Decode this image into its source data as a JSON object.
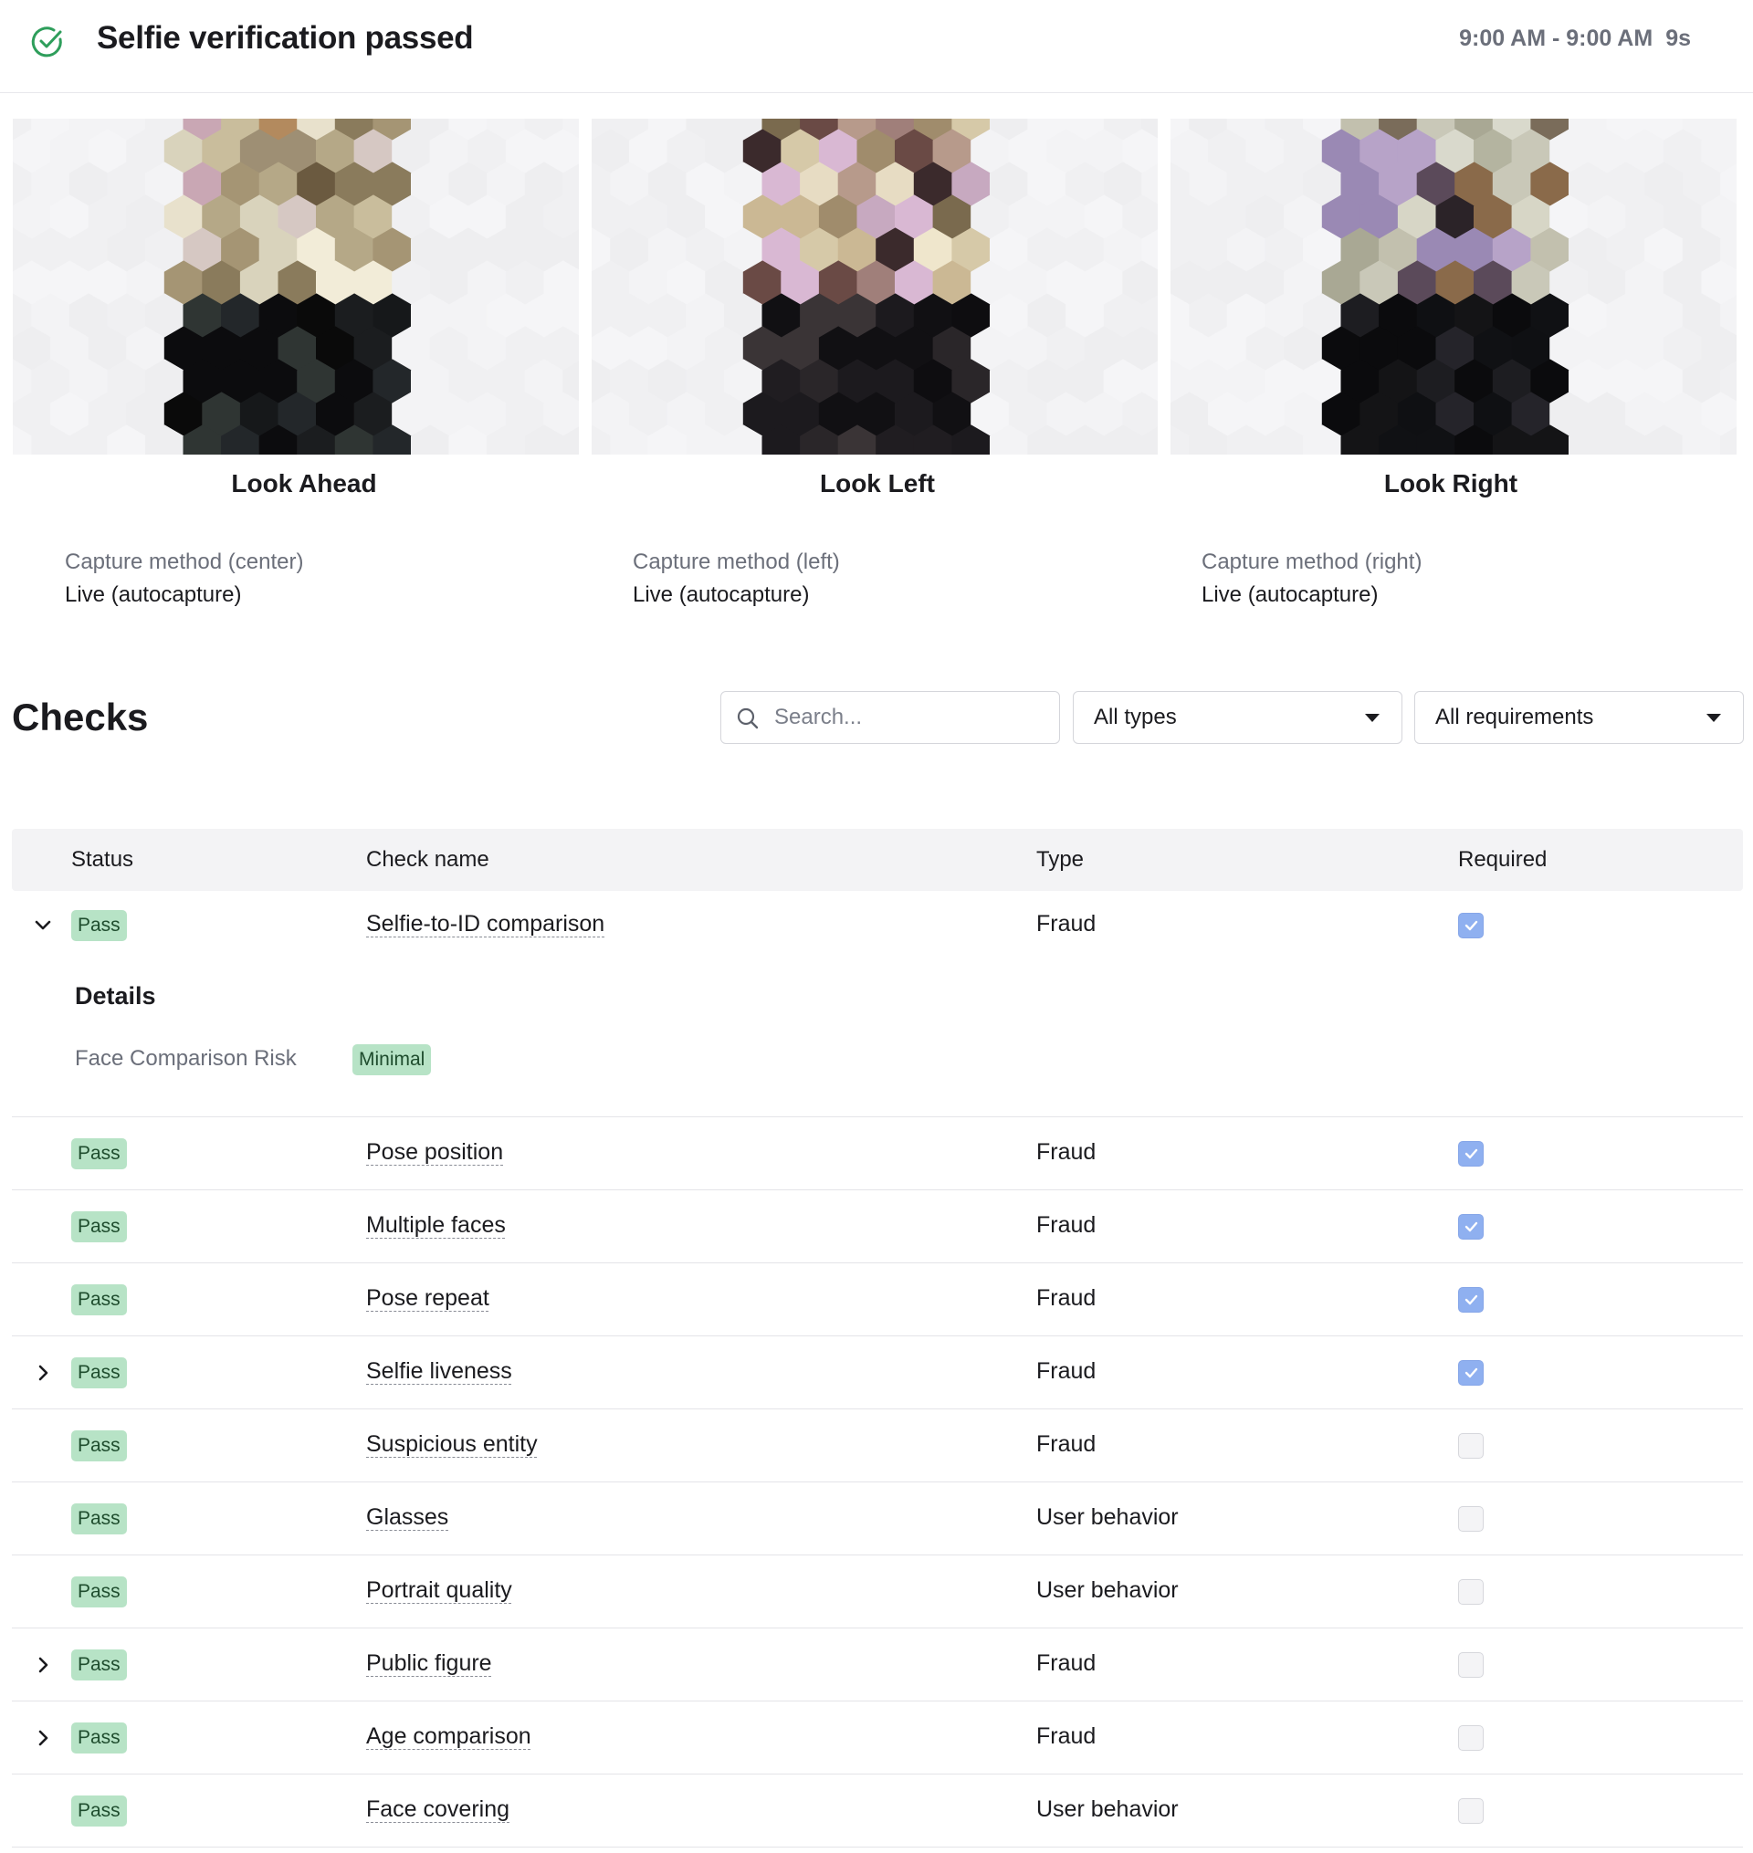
{
  "header": {
    "title": "Selfie verification passed",
    "time_range": "9:00 AM - 9:00 AM",
    "duration": "9s",
    "icon": "check-circle-icon",
    "icon_color": "#2e9e5b"
  },
  "selfies": [
    {
      "label": "Look Ahead",
      "capture_label": "Capture method (center)",
      "capture_value": "Live (autocapture)"
    },
    {
      "label": "Look Left",
      "capture_label": "Capture method (left)",
      "capture_value": "Live (autocapture)"
    },
    {
      "label": "Look Right",
      "capture_label": "Capture method (right)",
      "capture_value": "Live (autocapture)"
    }
  ],
  "checks": {
    "title": "Checks",
    "search_placeholder": "Search...",
    "type_filter": "All types",
    "requirement_filter": "All requirements",
    "columns": [
      "Status",
      "Check name",
      "Type",
      "Required"
    ],
    "details": {
      "title": "Details",
      "key": "Face Comparison Risk",
      "value": "Minimal"
    },
    "rows": [
      {
        "status": "Pass",
        "name": "Selfie-to-ID comparison",
        "type": "Fraud",
        "required": true,
        "expander": "expanded"
      },
      {
        "status": "Pass",
        "name": "Pose position",
        "type": "Fraud",
        "required": true,
        "expander": "none"
      },
      {
        "status": "Pass",
        "name": "Multiple faces",
        "type": "Fraud",
        "required": true,
        "expander": "none"
      },
      {
        "status": "Pass",
        "name": "Pose repeat",
        "type": "Fraud",
        "required": true,
        "expander": "none"
      },
      {
        "status": "Pass",
        "name": "Selfie liveness",
        "type": "Fraud",
        "required": true,
        "expander": "collapsed"
      },
      {
        "status": "Pass",
        "name": "Suspicious entity",
        "type": "Fraud",
        "required": false,
        "expander": "none"
      },
      {
        "status": "Pass",
        "name": "Glasses",
        "type": "User behavior",
        "required": false,
        "expander": "none"
      },
      {
        "status": "Pass",
        "name": "Portrait quality",
        "type": "User behavior",
        "required": false,
        "expander": "none"
      },
      {
        "status": "Pass",
        "name": "Public figure",
        "type": "Fraud",
        "required": false,
        "expander": "collapsed"
      },
      {
        "status": "Pass",
        "name": "Age comparison",
        "type": "Fraud",
        "required": false,
        "expander": "collapsed"
      },
      {
        "status": "Pass",
        "name": "Face covering",
        "type": "User behavior",
        "required": false,
        "expander": "none"
      }
    ]
  },
  "colors": {
    "pass_badge_bg": "#b7e3c6",
    "pass_badge_text": "#1f4d2e",
    "checkbox_checked": "#8fb0f0",
    "header_bg": "#f3f3f5"
  }
}
